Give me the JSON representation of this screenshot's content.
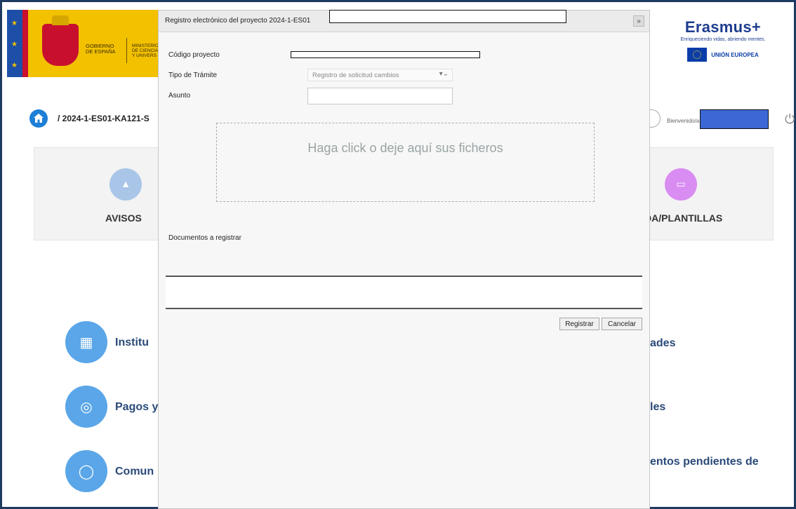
{
  "header": {
    "gov_logo": {
      "line1": "Gobierno",
      "line2": "de España",
      "ministry1": "Ministerio",
      "ministry2": "de Ciencia",
      "ministry3": "y Univers"
    },
    "erasmus": {
      "title": "Erasmus+",
      "tagline": "Enriqueciendo vidas, abriendo mentes.",
      "eu": "UNIÓN EUROPEA"
    },
    "breadcrumb": "/ 2024-1-ES01-KA121-S",
    "welcome": "Bienvenido/a"
  },
  "tiles": [
    {
      "label": "AVISOS",
      "icon": "bell-icon"
    },
    {
      "label": "DA/PLANTILLAS",
      "icon": "folder-icon"
    }
  ],
  "menu": [
    {
      "label": "Institu",
      "icon": "building-icon"
    },
    {
      "label": "Pagos y",
      "icon": "coins-icon"
    },
    {
      "label": "Comun",
      "icon": "chat-icon"
    }
  ],
  "menu_right": [
    "ades",
    "les",
    "entos pendientes de"
  ],
  "dialog": {
    "title": "Registro electrónico del proyecto 2024-1-ES01",
    "close_label": "»",
    "fields": {
      "codigo_label": "Código proyecto",
      "tramite_label": "Tipo de Trámite",
      "tramite_value": "Registro de solicitud cambios",
      "asunto_label": "Asunto",
      "asunto_value": ""
    },
    "dropzone_text": "Haga click o deje aquí sus ficheros",
    "documents_label": "Documentos a registrar",
    "buttons": {
      "register": "Registrar",
      "cancel": "Cancelar"
    }
  },
  "colors": {
    "accent": "#1d7fd6",
    "erasmus_blue": "#1e3d8f",
    "gov_yellow": "#f2c100",
    "avisos": "#a9c6e8",
    "plantillas": "#d98cf2"
  }
}
